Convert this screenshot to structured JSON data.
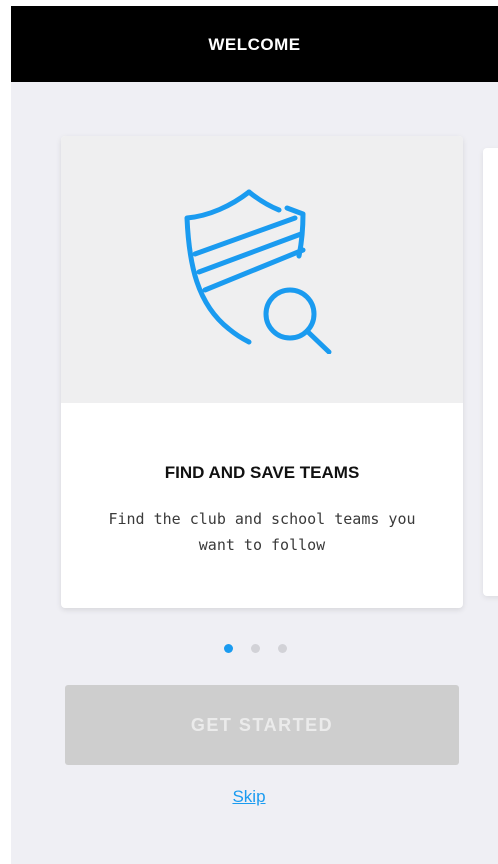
{
  "header": {
    "title": "WELCOME"
  },
  "onboarding": {
    "slides": [
      {
        "icon": "shield-search-icon",
        "title": "FIND AND SAVE TEAMS",
        "description": "Find the club and school teams you want to follow"
      }
    ],
    "pagination": {
      "total": 3,
      "active_index": 0
    }
  },
  "actions": {
    "get_started_label": "GET STARTED",
    "skip_label": "Skip"
  },
  "colors": {
    "accent": "#1a9bf0",
    "header_bg": "#000000",
    "screen_bg": "#efeff4",
    "button_disabled_bg": "#cecece"
  }
}
